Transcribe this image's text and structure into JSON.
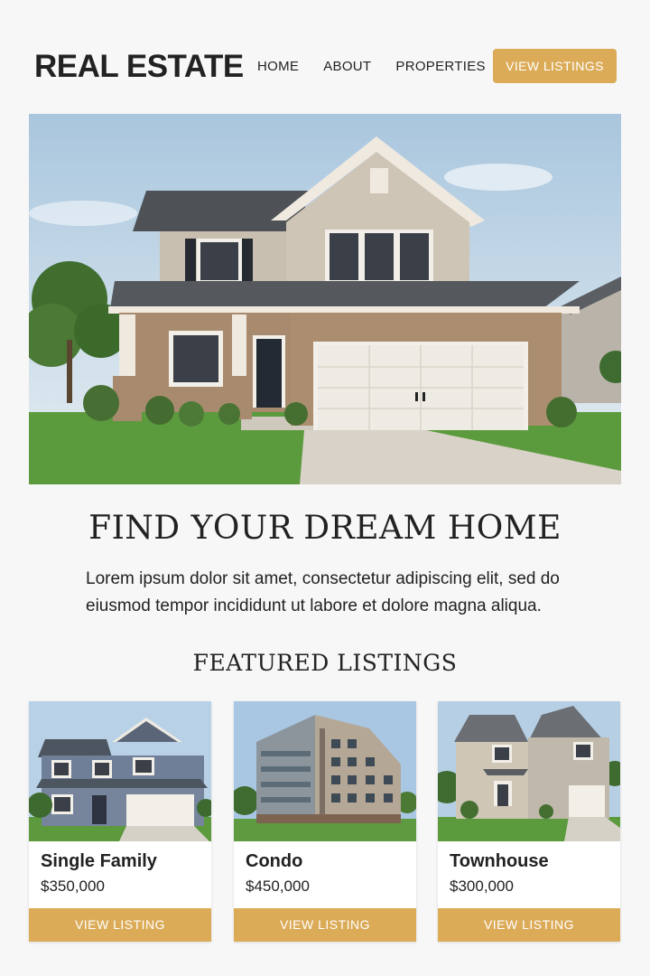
{
  "header": {
    "logo": "REAL ESTATE",
    "nav": [
      "HOME",
      "ABOUT",
      "PROPERTIES"
    ],
    "cta_label": "VIEW LISTINGS"
  },
  "hero": {
    "headline": "FIND YOUR DREAM HOME",
    "intro": "Lorem ipsum dolor sit amet, consectetur adipiscing elit, sed do eiusmod tempor incididunt ut labore et dolore magna aliqua."
  },
  "featured": {
    "title": "FEATURED LISTINGS",
    "listings": [
      {
        "name": "Single Family",
        "price": "$350,000",
        "button": "VIEW LISTING"
      },
      {
        "name": "Condo",
        "price": "$450,000",
        "button": "VIEW LISTING"
      },
      {
        "name": "Townhouse",
        "price": "$300,000",
        "button": "VIEW LISTING"
      }
    ]
  },
  "colors": {
    "accent": "#dbab58",
    "text": "#222222",
    "background": "#f7f7f7"
  }
}
